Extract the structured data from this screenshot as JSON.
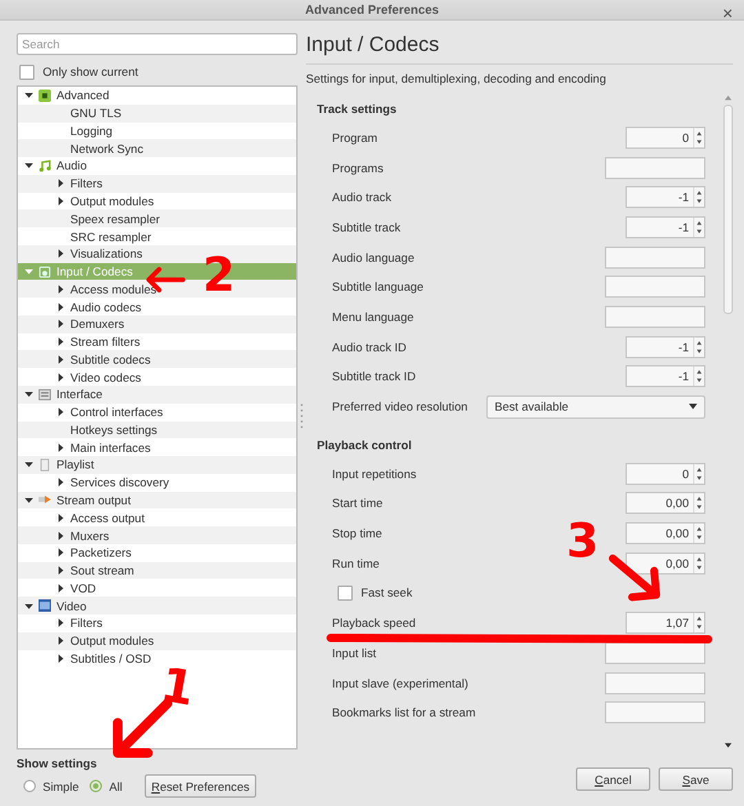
{
  "window": {
    "title": "Advanced Preferences",
    "close": "×"
  },
  "sidebar": {
    "search": {
      "placeholder": "Search"
    },
    "only_show_current": {
      "label": "Only show current",
      "checked": false
    },
    "tree": [
      {
        "label": "Advanced",
        "expanded": true,
        "selected": false,
        "children": [
          {
            "label": "GNU TLS",
            "expandable": false,
            "selected": false
          },
          {
            "label": "Logging",
            "expandable": false,
            "selected": false
          },
          {
            "label": "Network Sync",
            "expandable": false,
            "selected": false
          }
        ]
      },
      {
        "label": "Audio",
        "expanded": true,
        "selected": false,
        "children": [
          {
            "label": "Filters",
            "expandable": true,
            "selected": false
          },
          {
            "label": "Output modules",
            "expandable": true,
            "selected": false
          },
          {
            "label": "Speex resampler",
            "expandable": false,
            "selected": false
          },
          {
            "label": "SRC resampler",
            "expandable": false,
            "selected": false
          },
          {
            "label": "Visualizations",
            "expandable": true,
            "selected": false
          }
        ]
      },
      {
        "label": "Input / Codecs",
        "expanded": true,
        "selected": true,
        "children": [
          {
            "label": "Access modules",
            "expandable": true,
            "selected": false
          },
          {
            "label": "Audio codecs",
            "expandable": true,
            "selected": false
          },
          {
            "label": "Demuxers",
            "expandable": true,
            "selected": false
          },
          {
            "label": "Stream filters",
            "expandable": true,
            "selected": false
          },
          {
            "label": "Subtitle codecs",
            "expandable": true,
            "selected": false
          },
          {
            "label": "Video codecs",
            "expandable": true,
            "selected": false
          }
        ]
      },
      {
        "label": "Interface",
        "expanded": true,
        "selected": false,
        "children": [
          {
            "label": "Control interfaces",
            "expandable": true,
            "selected": false
          },
          {
            "label": "Hotkeys settings",
            "expandable": false,
            "selected": false
          },
          {
            "label": "Main interfaces",
            "expandable": true,
            "selected": false
          }
        ]
      },
      {
        "label": "Playlist",
        "expanded": true,
        "selected": false,
        "children": [
          {
            "label": "Services discovery",
            "expandable": true,
            "selected": false
          }
        ]
      },
      {
        "label": "Stream output",
        "expanded": true,
        "selected": false,
        "children": [
          {
            "label": "Access output",
            "expandable": true,
            "selected": false
          },
          {
            "label": "Muxers",
            "expandable": true,
            "selected": false
          },
          {
            "label": "Packetizers",
            "expandable": true,
            "selected": false
          },
          {
            "label": "Sout stream",
            "expandable": true,
            "selected": false
          },
          {
            "label": "VOD",
            "expandable": true,
            "selected": false
          }
        ]
      },
      {
        "label": "Video",
        "expanded": true,
        "selected": false,
        "children": [
          {
            "label": "Filters",
            "expandable": true,
            "selected": false
          },
          {
            "label": "Output modules",
            "expandable": true,
            "selected": false
          },
          {
            "label": "Subtitles / OSD",
            "expandable": true,
            "selected": false
          }
        ]
      }
    ],
    "show_settings": {
      "label": "Show settings",
      "options": [
        {
          "label": "Simple",
          "selected": false
        },
        {
          "label": "All",
          "selected": true
        }
      ]
    },
    "reset_button": "Reset Preferences"
  },
  "panel": {
    "title": "Input / Codecs",
    "subtitle": "Settings for input, demultiplexing, decoding and encoding",
    "sections": [
      {
        "title": "Track settings",
        "rows": [
          {
            "kind": "spin",
            "label": "Program",
            "value": "0"
          },
          {
            "kind": "text",
            "label": "Programs"
          },
          {
            "kind": "spin",
            "label": "Audio track",
            "value": "-1"
          },
          {
            "kind": "spin",
            "label": "Subtitle track",
            "value": "-1"
          },
          {
            "kind": "text",
            "label": "Audio language"
          },
          {
            "kind": "text",
            "label": "Subtitle language"
          },
          {
            "kind": "text",
            "label": "Menu language"
          },
          {
            "kind": "spin",
            "label": "Audio track ID",
            "value": "-1"
          },
          {
            "kind": "spin",
            "label": "Subtitle track ID",
            "value": "-1"
          },
          {
            "kind": "combo",
            "label": "Preferred video resolution",
            "value": "Best available"
          }
        ]
      },
      {
        "title": "Playback control",
        "rows": [
          {
            "kind": "spin",
            "label": "Input repetitions",
            "value": "0"
          },
          {
            "kind": "spin",
            "label": "Start time",
            "value": "0,00"
          },
          {
            "kind": "spin",
            "label": "Stop time",
            "value": "0,00"
          },
          {
            "kind": "spin",
            "label": "Run time",
            "value": "0,00"
          },
          {
            "kind": "check",
            "label": "Fast seek",
            "checked": false
          },
          {
            "kind": "spin",
            "label": "Playback speed",
            "value": "1,07"
          },
          {
            "kind": "text",
            "label": "Input list"
          },
          {
            "kind": "text",
            "label": "Input slave (experimental)"
          },
          {
            "kind": "text",
            "label": "Bookmarks list for a stream"
          }
        ]
      }
    ]
  },
  "buttons": [
    "Cancel",
    "Save"
  ],
  "annotations": [
    {
      "label": "2"
    },
    {
      "label": "1"
    },
    {
      "label": "3"
    }
  ]
}
